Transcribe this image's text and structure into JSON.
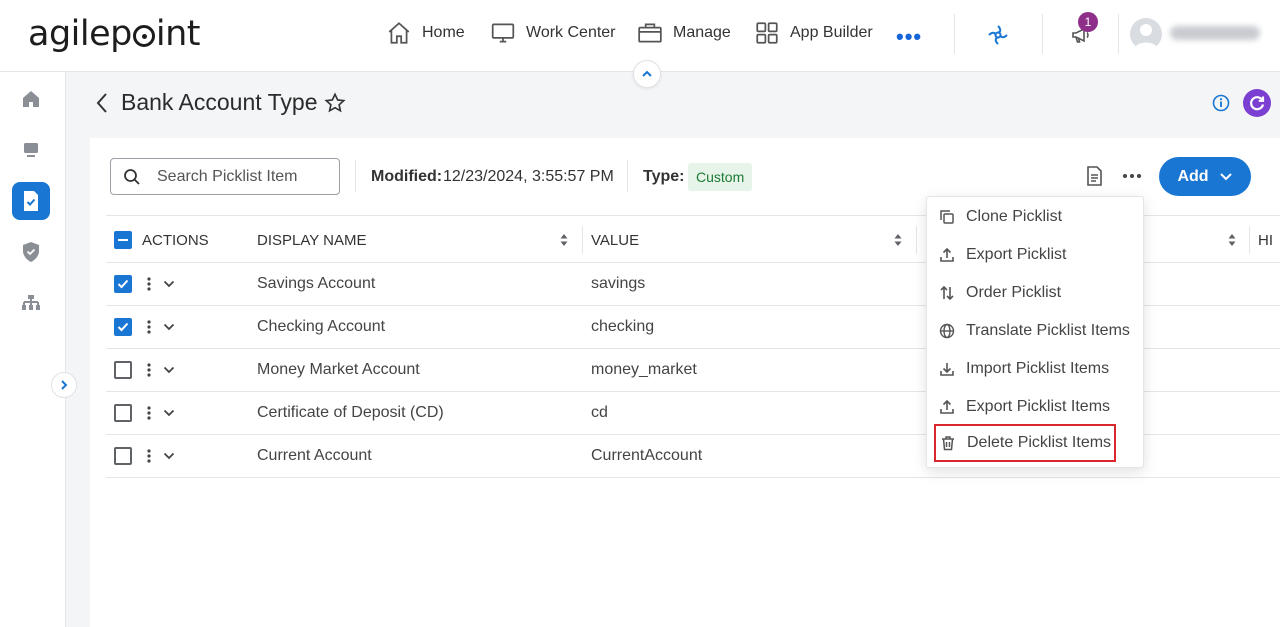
{
  "app": {
    "logo_text": "agilepoint"
  },
  "nav": {
    "home": "Home",
    "work_center": "Work Center",
    "manage": "Manage",
    "app_builder": "App Builder",
    "more": "•••",
    "notification_count": "1"
  },
  "page": {
    "title": "Bank Account Type"
  },
  "toolbar": {
    "search_placeholder": "Search Picklist Item",
    "modified_label": "Modified:",
    "modified_value": "12/23/2024, 3:55:57 PM",
    "type_label": "Type:",
    "type_value": "Custom",
    "add_label": "Add"
  },
  "table": {
    "headers": [
      "ACTIONS",
      "DISPLAY NAME",
      "VALUE",
      "HI"
    ],
    "rows": [
      {
        "checked": true,
        "display_name": "Savings Account",
        "value": "savings"
      },
      {
        "checked": true,
        "display_name": "Checking Account",
        "value": "checking"
      },
      {
        "checked": false,
        "display_name": "Money Market Account",
        "value": "money_market"
      },
      {
        "checked": false,
        "display_name": "Certificate of Deposit (CD)",
        "value": "cd"
      },
      {
        "checked": false,
        "display_name": "Current Account",
        "value": "CurrentAccount"
      }
    ]
  },
  "menu": {
    "items": [
      {
        "label": "Clone Picklist",
        "icon": "clone-icon"
      },
      {
        "label": "Export Picklist",
        "icon": "export-icon"
      },
      {
        "label": "Order Picklist",
        "icon": "sort-icon"
      },
      {
        "label": "Translate Picklist Items",
        "icon": "globe-icon"
      },
      {
        "label": "Import Picklist Items",
        "icon": "import-icon"
      },
      {
        "label": "Export Picklist Items",
        "icon": "export-icon"
      },
      {
        "label": "Delete Picklist Items",
        "icon": "trash-icon"
      }
    ]
  },
  "colors": {
    "accent": "#1976d2",
    "highlight": "#d9272e",
    "badge": "#8e2f8a",
    "refresh": "#7b3fd1",
    "chip_bg": "#e6f4ea",
    "chip_text": "#1e7b34"
  }
}
